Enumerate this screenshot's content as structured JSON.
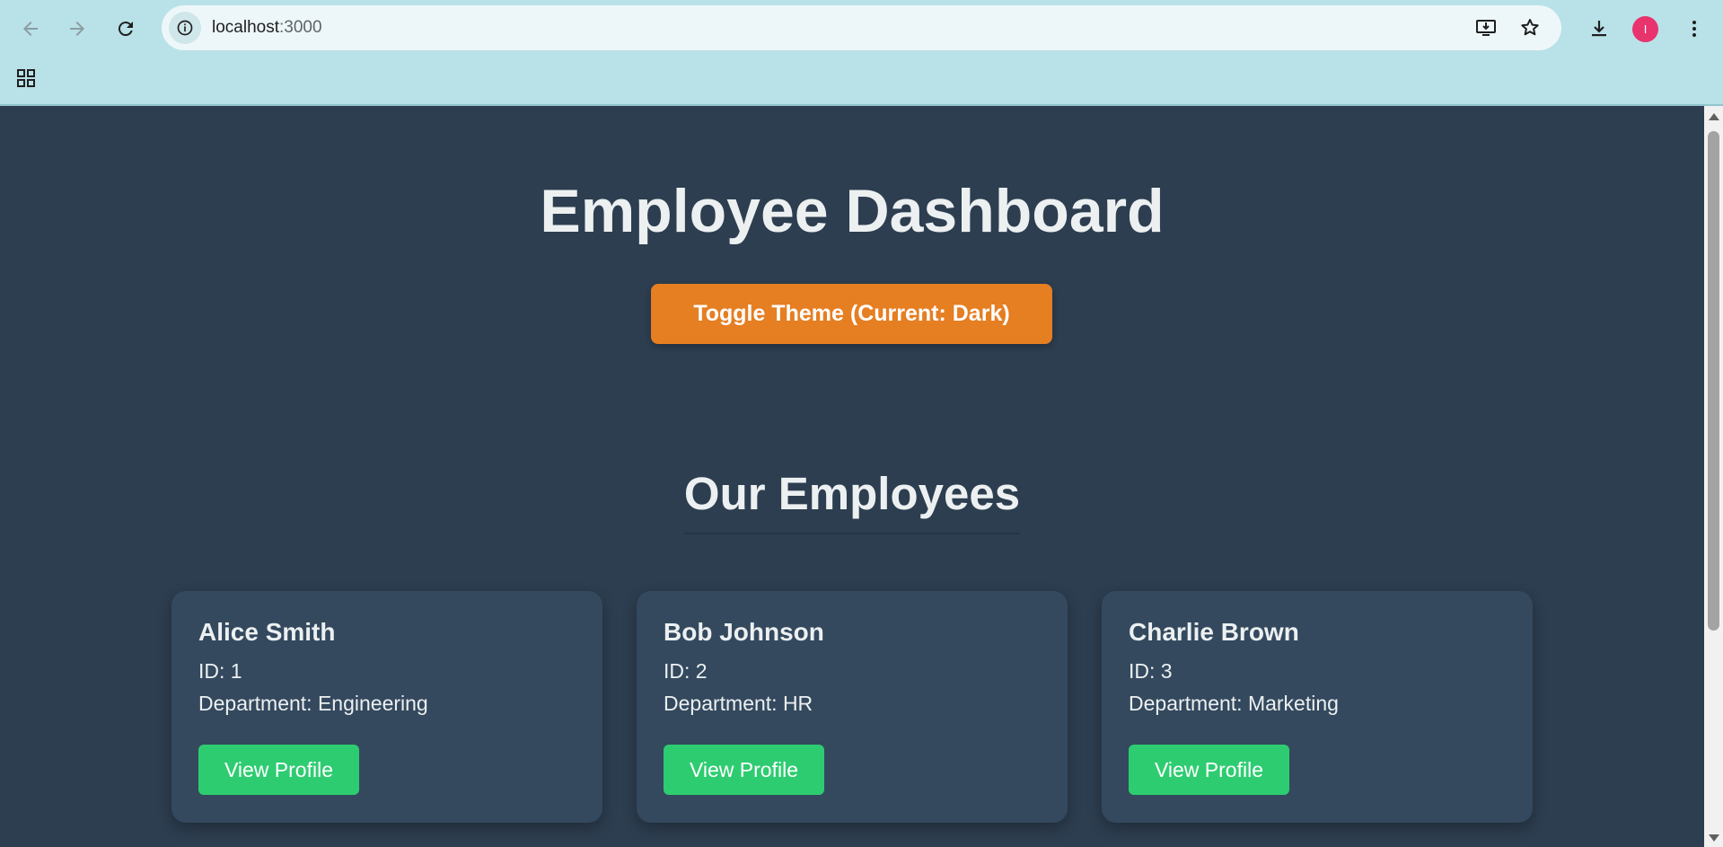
{
  "browser": {
    "url_host": "localhost",
    "url_port": ":3000"
  },
  "page": {
    "title": "Employee Dashboard",
    "toggle_label": "Toggle Theme (Current: Dark)",
    "section_title": "Our Employees"
  },
  "employees": [
    {
      "name": "Alice Smith",
      "id": "ID: 1",
      "department": "Department: Engineering",
      "button": "View Profile"
    },
    {
      "name": "Bob Johnson",
      "id": "ID: 2",
      "department": "Department: HR",
      "button": "View Profile"
    },
    {
      "name": "Charlie Brown",
      "id": "ID: 3",
      "department": "Department: Marketing",
      "button": "View Profile"
    }
  ],
  "colors": {
    "page_background": "#2d3e50",
    "card_background": "#34495e",
    "accent_orange": "#e67e22",
    "button_green": "#2ecc71",
    "text_light": "#ecf0f1",
    "avatar": "#e8336d"
  },
  "icons": [
    "back-icon",
    "forward-icon",
    "reload-icon",
    "site-info-icon",
    "install-app-icon",
    "bookmark-star-icon",
    "download-icon",
    "profile-avatar",
    "more-menu-icon",
    "apps-grid-icon"
  ],
  "avatar_letter": "I"
}
